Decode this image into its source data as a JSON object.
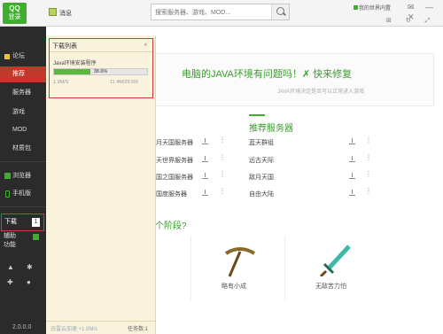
{
  "titlebar": {
    "login": "登录",
    "login_badge": "QQ",
    "messages": "消息",
    "search_placeholder": "搜索服务器、游戏、MOD...",
    "my_world": "我的世界内置",
    "window_controls": "✉ — ✕",
    "tool_icons": "⊞ ↻ ⤢"
  },
  "sidebar": {
    "items": [
      {
        "label": "论坛"
      },
      {
        "label": "推荐"
      },
      {
        "label": "服务器"
      },
      {
        "label": "游戏"
      },
      {
        "label": "MOD"
      },
      {
        "label": "材质包"
      },
      {
        "label": "浏览器"
      },
      {
        "label": "手机版"
      }
    ],
    "download": {
      "label": "下载",
      "count": "1"
    },
    "help": {
      "label": "辅助\n功能"
    },
    "version": "2.0.0.0"
  },
  "banner": {
    "text": "电脑的JAVA环境有问题吗！✗ 快来修复",
    "sub": "JAVA环境决定是否可以正常进入游戏"
  },
  "recommended": {
    "title": "推荐服务器",
    "left_col": [
      "月天国服务器",
      "天世界服务器",
      "国之国服务器",
      "国度服务器"
    ],
    "right_col": [
      "蓝天群组",
      "远古天际",
      "敌月天国",
      "自由大陆"
    ]
  },
  "stages": {
    "question": "个阶段?",
    "items": [
      {
        "label": "略有小成"
      },
      {
        "label": "无敌苦力怕"
      }
    ]
  },
  "download_panel": {
    "title": "下载列表",
    "close": "×",
    "task": {
      "name": "Java环境安装程序",
      "progress_text": "38.6%",
      "progress": 0.386,
      "speed": "1.9M/S",
      "size": "11.4M/29.5M"
    },
    "accel": "迅雷云加速 +1.9M/s",
    "task_count": "任务数:1"
  },
  "colors": {
    "accent_green": "#3fae2e",
    "sidebar_bg": "#2b2b2b",
    "active_red": "#c0392b",
    "panel_bg": "#f9f3dd"
  }
}
